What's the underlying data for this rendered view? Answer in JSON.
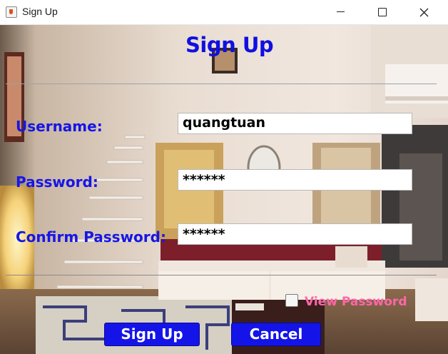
{
  "window": {
    "title": "Sign Up",
    "icon": "java-cup-icon",
    "controls": [
      "minimize-icon",
      "maximize-icon",
      "close-icon"
    ]
  },
  "form": {
    "heading": "Sign Up",
    "username_label": "Username:",
    "username_value": "quangtuan",
    "password_label": "Password:",
    "password_value": "******",
    "confirm_label": "Confirm Password:",
    "confirm_value": "******",
    "view_password_label": "View Password",
    "view_password_checked": false,
    "signup_button": "Sign Up",
    "cancel_button": "Cancel"
  },
  "colors": {
    "label_blue": "#1616e6",
    "button_blue": "#1414e8",
    "view_password_pink": "#ff66aa"
  }
}
